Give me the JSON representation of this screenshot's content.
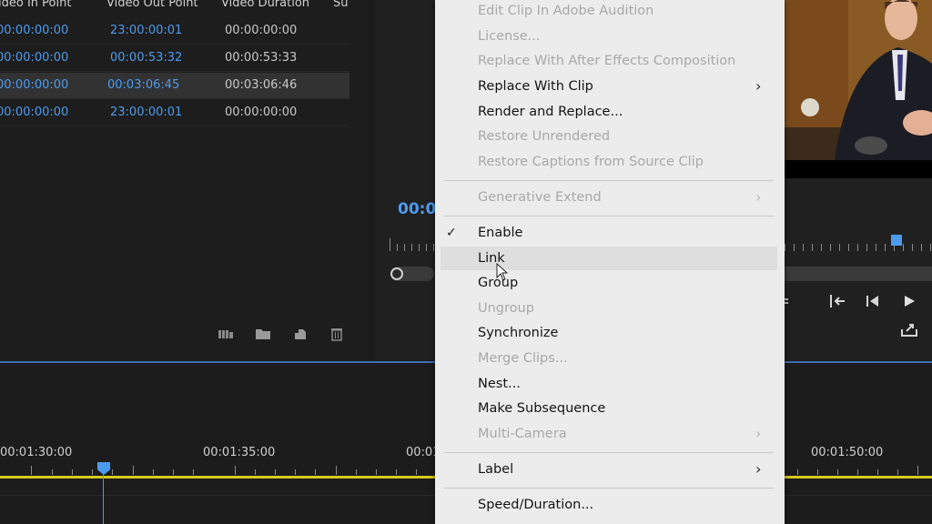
{
  "project_panel": {
    "columns": [
      "ideo In Point",
      "Video Out Point",
      "Video Duration",
      "Su"
    ],
    "rows": [
      {
        "in": "00:00:00:00",
        "out": "23:00:00:01",
        "duration": "00:00:00:00"
      },
      {
        "in": "00:00:00:00",
        "out": "00:00:53:32",
        "duration": "00:00:53:33"
      },
      {
        "in": "00:00:00:00",
        "out": "00:03:06:45",
        "duration": "00:03:06:46"
      },
      {
        "in": "00:00:00:00",
        "out": "23:00:00:01",
        "duration": "00:00:00:00"
      }
    ],
    "footer_icons": [
      "freeform-view-icon",
      "new-bin-icon",
      "new-item-icon",
      "trash-icon"
    ]
  },
  "monitor": {
    "timecode": "00:0",
    "controls_icons": [
      "go-to-in-icon",
      "step-back-icon",
      "play-icon",
      "export-frame-icon"
    ],
    "accent_color": "#4d9bef"
  },
  "timeline": {
    "times": [
      "00:01:30:00",
      "00:01:35:00",
      "00:01",
      "00:01:50:00"
    ],
    "playhead_color": "#4d9bef",
    "line_color": "#d8c81d"
  },
  "context_menu": {
    "items": [
      {
        "label": "Edit Clip In Adobe Audition",
        "enabled": false
      },
      {
        "label": "License...",
        "enabled": false
      },
      {
        "label": "Replace With After Effects Composition",
        "enabled": false
      },
      {
        "label": "Replace With Clip",
        "enabled": true,
        "submenu": true
      },
      {
        "label": "Render and Replace...",
        "enabled": true
      },
      {
        "label": "Restore Unrendered",
        "enabled": false
      },
      {
        "label": "Restore Captions from Source Clip",
        "enabled": false
      },
      {
        "label": "Generative Extend",
        "enabled": false,
        "submenu": true
      },
      {
        "label": "Enable",
        "enabled": true,
        "checked": true
      },
      {
        "label": "Link",
        "enabled": true,
        "hovered": true
      },
      {
        "label": "Group",
        "enabled": true
      },
      {
        "label": "Ungroup",
        "enabled": false
      },
      {
        "label": "Synchronize",
        "enabled": true
      },
      {
        "label": "Merge Clips...",
        "enabled": false
      },
      {
        "label": "Nest...",
        "enabled": true
      },
      {
        "label": "Make Subsequence",
        "enabled": true
      },
      {
        "label": "Multi-Camera",
        "enabled": false,
        "submenu": true
      },
      {
        "label": "Label",
        "enabled": true,
        "submenu": true
      },
      {
        "label": "Speed/Duration...",
        "enabled": true
      }
    ],
    "submenu_glyph": "›",
    "check_glyph": "✓"
  }
}
